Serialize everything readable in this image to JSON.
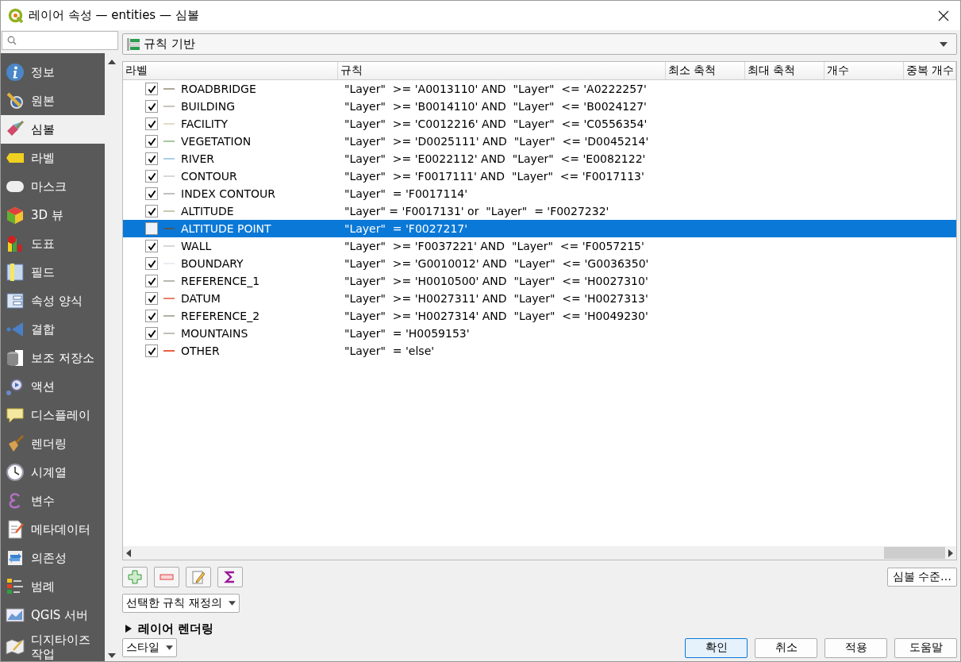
{
  "window": {
    "title": "레이어 속성 — entities — 심볼"
  },
  "sidebar": {
    "items": [
      {
        "label": "정보",
        "selected": false
      },
      {
        "label": "원본",
        "selected": false
      },
      {
        "label": "심볼",
        "selected": true
      },
      {
        "label": "라벨",
        "selected": false
      },
      {
        "label": "마스크",
        "selected": false
      },
      {
        "label": "3D 뷰",
        "selected": false
      },
      {
        "label": "도표",
        "selected": false
      },
      {
        "label": "필드",
        "selected": false
      },
      {
        "label": "속성 양식",
        "selected": false
      },
      {
        "label": "결합",
        "selected": false
      },
      {
        "label": "보조 저장소",
        "selected": false
      },
      {
        "label": "액션",
        "selected": false
      },
      {
        "label": "디스플레이",
        "selected": false
      },
      {
        "label": "렌더링",
        "selected": false
      },
      {
        "label": "시계열",
        "selected": false
      },
      {
        "label": "변수",
        "selected": false
      },
      {
        "label": "메타데이터",
        "selected": false
      },
      {
        "label": "의존성",
        "selected": false
      },
      {
        "label": "범례",
        "selected": false
      },
      {
        "label": "QGIS 서버",
        "selected": false
      },
      {
        "label": "디지타이즈 작업",
        "selected": false
      }
    ]
  },
  "renderer": {
    "value": "규칙 기반"
  },
  "table": {
    "columns": [
      "라벨",
      "규칙",
      "최소 축척",
      "최대 축척",
      "개수",
      "중복 개수"
    ],
    "rows": [
      {
        "label": "ROADBRIDGE",
        "rule": "\"Layer\"  >= 'A0013110' AND  \"Layer\"  <= 'A0222257'",
        "checked": true,
        "selected": false,
        "color": "#b0a898"
      },
      {
        "label": "BUILDING",
        "rule": "\"Layer\"  >= 'B0014110' AND  \"Layer\"  <= 'B0024127'",
        "checked": true,
        "selected": false,
        "color": "#c8c4bc"
      },
      {
        "label": "FACILITY",
        "rule": "\"Layer\"  >= 'C0012216' AND  \"Layer\"  <= 'C0556354'",
        "checked": true,
        "selected": false,
        "color": "#e0dccc"
      },
      {
        "label": "VEGETATION",
        "rule": "\"Layer\"  >= 'D0025111' AND  \"Layer\"  <= 'D0045214'",
        "checked": true,
        "selected": false,
        "color": "#a8c8a0"
      },
      {
        "label": "RIVER",
        "rule": "\"Layer\"  >= 'E0022112' AND  \"Layer\"  <= 'E0082122'",
        "checked": true,
        "selected": false,
        "color": "#a8d0e8"
      },
      {
        "label": "CONTOUR",
        "rule": "\"Layer\"  >= 'F0017111' AND  \"Layer\"  <= 'F0017113'",
        "checked": true,
        "selected": false,
        "color": "#d8d8d8"
      },
      {
        "label": "INDEX CONTOUR",
        "rule": "\"Layer\"  = 'F0017114'",
        "checked": true,
        "selected": false,
        "color": "#c0c0c0"
      },
      {
        "label": "ALTITUDE",
        "rule": "\"Layer\" = 'F0017131' or  \"Layer\"  = 'F0027232'",
        "checked": true,
        "selected": false,
        "color": "#c8c8b0"
      },
      {
        "label": "ALTITUDE POINT",
        "rule": "\"Layer\"  = 'F0027217'",
        "checked": false,
        "selected": true,
        "color": "#505860"
      },
      {
        "label": "WALL",
        "rule": "\"Layer\"  >= 'F0037221' AND  \"Layer\"  <= 'F0057215'",
        "checked": true,
        "selected": false,
        "color": "#d8d8d8"
      },
      {
        "label": "BOUNDARY",
        "rule": "\"Layer\"  >= 'G0010012' AND  \"Layer\"  <= 'G0036350'",
        "checked": true,
        "selected": false,
        "color": "#ececf2"
      },
      {
        "label": "REFERENCE_1",
        "rule": "\"Layer\"  >= 'H0010500' AND  \"Layer\"  <= 'H0027310'",
        "checked": true,
        "selected": false,
        "color": "#b8b8b0"
      },
      {
        "label": "DATUM",
        "rule": "\"Layer\"  >= 'H0027311' AND  \"Layer\"  <= 'H0027313'",
        "checked": true,
        "selected": false,
        "color": "#e8806a"
      },
      {
        "label": "REFERENCE_2",
        "rule": "\"Layer\"  >= 'H0027314' AND  \"Layer\"  <= 'H0049230'",
        "checked": true,
        "selected": false,
        "color": "#b0b0a0"
      },
      {
        "label": "MOUNTAINS",
        "rule": "\"Layer\"  = 'H0059153'",
        "checked": true,
        "selected": false,
        "color": "#c0c0b8"
      },
      {
        "label": "OTHER",
        "rule": "\"Layer\"  = 'else'",
        "checked": true,
        "selected": false,
        "color": "#e86040"
      }
    ]
  },
  "symbol_levels_button": "심볼 수준…",
  "override_dropdown": {
    "value": "선택한 규칙 재정의"
  },
  "layer_rendering": {
    "label": "레이어 렌더링",
    "expanded": false
  },
  "style_dropdown": {
    "value": "스타일"
  },
  "buttons": [
    {
      "label": "확인",
      "default": true
    },
    {
      "label": "취소",
      "default": false
    },
    {
      "label": "적용",
      "default": false
    },
    {
      "label": "도움말",
      "default": false
    }
  ]
}
